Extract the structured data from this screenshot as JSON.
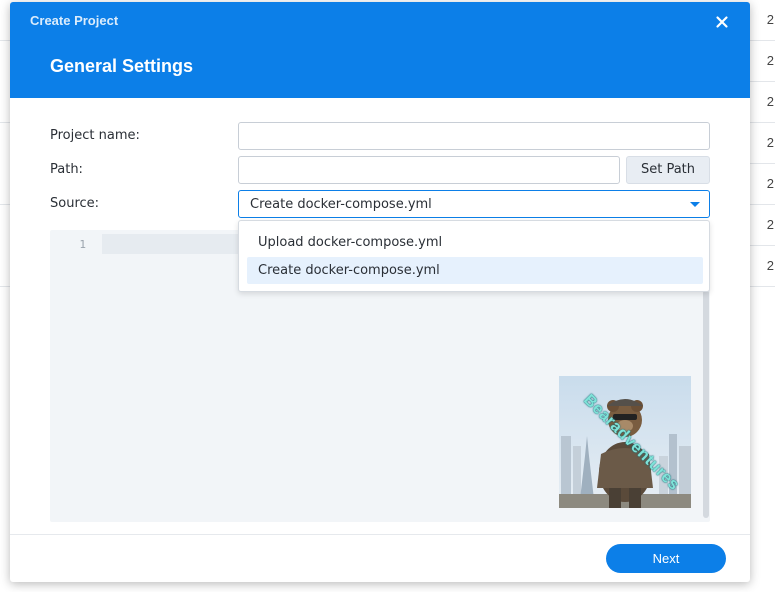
{
  "background_table": {
    "row_values": [
      "2",
      "2",
      "2",
      "2",
      "2",
      "2",
      "2"
    ]
  },
  "dialog": {
    "title": "Create Project",
    "heading": "General Settings",
    "close_icon": "close-icon"
  },
  "form": {
    "project_name": {
      "label": "Project name:",
      "value": "",
      "placeholder": ""
    },
    "path": {
      "label": "Path:",
      "value": "",
      "placeholder": "",
      "button_label": "Set Path"
    },
    "source": {
      "label": "Source:",
      "selected": "Create docker-compose.yml",
      "options": [
        {
          "label": "Upload docker-compose.yml",
          "selected": false
        },
        {
          "label": "Create docker-compose.yml",
          "selected": true
        }
      ]
    }
  },
  "editor": {
    "line_numbers": [
      "1"
    ]
  },
  "watermark": {
    "text": "Bearadventures"
  },
  "footer": {
    "next_label": "Next"
  },
  "colors": {
    "accent": "#0c7fe8",
    "selected_option_bg": "#e6f1fd",
    "editor_bg": "#f2f5f8"
  }
}
